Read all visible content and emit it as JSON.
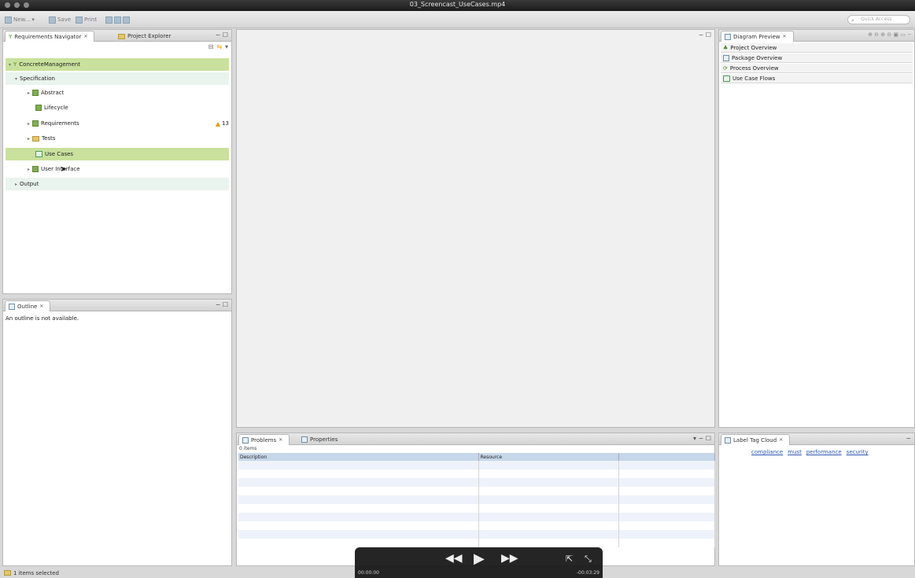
{
  "window": {
    "title": "03_Screencast_UseCases.mp4"
  },
  "toolbar": {
    "new_label": "New...",
    "save_label": "Save",
    "print_label": "Print",
    "search_placeholder": "Quick Access"
  },
  "navigator": {
    "tab_active": "Requirements Navigator",
    "tab_inactive": "Project Explorer",
    "items": [
      {
        "label": "ConcreteManagement",
        "level": 0,
        "icon": "project-icon",
        "selected": true
      },
      {
        "label": "Specification",
        "level": 1,
        "icon": "none"
      },
      {
        "label": "Abstract",
        "level": 2,
        "icon": "requirements-icon"
      },
      {
        "label": "Lifecycle",
        "level": 2,
        "icon": "requirements-icon"
      },
      {
        "label": "Requirements",
        "level": 2,
        "icon": "requirements-icon",
        "badge": "13"
      },
      {
        "label": "Tests",
        "level": 2,
        "icon": "folder-icon"
      },
      {
        "label": "Use Cases",
        "level": 2,
        "icon": "use-case-icon",
        "selected": true
      },
      {
        "label": "User Interface",
        "level": 2,
        "icon": "requirements-icon"
      },
      {
        "label": "Output",
        "level": 1,
        "icon": "none"
      }
    ]
  },
  "outline": {
    "tab": "Outline",
    "message": "An outline is not available."
  },
  "diagram_preview": {
    "tab": "Diagram Preview",
    "items": [
      "Project Overview",
      "Package Overview",
      "Process Overview",
      "Use Case Flows"
    ]
  },
  "problems": {
    "tab_active": "Problems",
    "tab_inactive": "Properties",
    "summary": "0 items",
    "columns": [
      "Description",
      "Resource",
      ""
    ]
  },
  "tag_cloud": {
    "tab": "Label Tag Cloud",
    "tags": [
      "compliance",
      "must",
      "performance",
      "security"
    ]
  },
  "video": {
    "elapsed": "00:00:00",
    "remaining": "-00:03:29"
  },
  "status": {
    "text": "1 items selected"
  }
}
